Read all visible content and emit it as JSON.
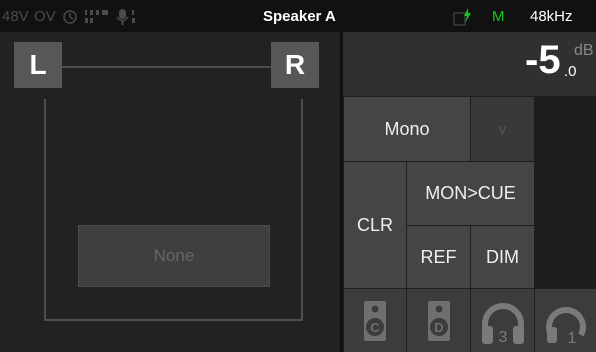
{
  "status_bar": {
    "phantom_label": "48V",
    "ov_label": "OV",
    "center_title": "Speaker A",
    "mode_letter": "M",
    "sample_rate": "48kHz"
  },
  "channels": {
    "left_label": "L",
    "right_label": "R",
    "source_label": "None"
  },
  "level": {
    "value": "-5",
    "decimal": ".0",
    "unit": "dB"
  },
  "buttons": {
    "mono": "Mono",
    "arrow": "v",
    "mon_cue": "MON>CUE",
    "clr": "CLR",
    "ref": "REF",
    "dim": "DIM"
  },
  "outputs": {
    "speaker_c": "C",
    "speaker_d": "D",
    "headphone_num": "3",
    "headphone2_num": "1"
  },
  "colors": {
    "accent_green": "#19c51e",
    "button_gray": "#454545",
    "bg": "#232323"
  }
}
